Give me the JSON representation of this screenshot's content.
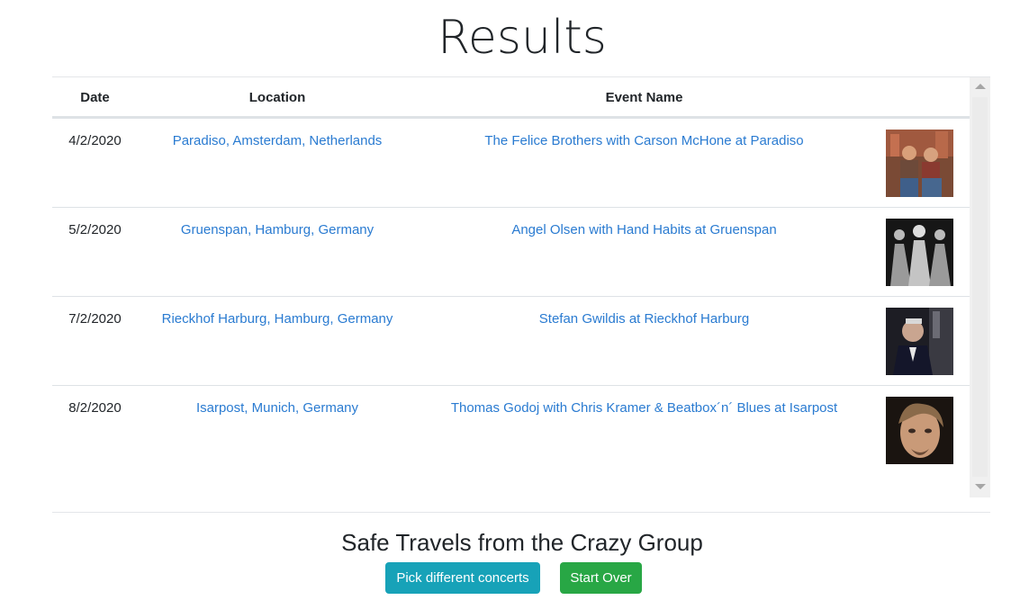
{
  "page": {
    "title": "Results"
  },
  "table": {
    "headers": {
      "date": "Date",
      "location": "Location",
      "event": "Event Name"
    },
    "rows": [
      {
        "date": "4/2/2020",
        "location": "Paradiso, Amsterdam, Netherlands",
        "event": "The Felice Brothers with Carson McHone at Paradiso",
        "image": "band-photo"
      },
      {
        "date": "5/2/2020",
        "location": "Gruenspan, Hamburg, Germany",
        "event": "Angel Olsen with Hand Habits at Gruenspan",
        "image": "artist-photo"
      },
      {
        "date": "7/2/2020",
        "location": "Rieckhof Harburg, Hamburg, Germany",
        "event": "Stefan Gwildis at Rieckhof Harburg",
        "image": "artist-photo"
      },
      {
        "date": "8/2/2020",
        "location": "Isarpost, Munich, Germany",
        "event": "Thomas Godoj with Chris Kramer & Beatbox´n´ Blues at Isarpost",
        "image": "artist-photo"
      }
    ]
  },
  "footer": {
    "message": "Safe Travels from the Crazy Group",
    "pick_button": "Pick different concerts",
    "start_over_button": "Start Over"
  },
  "colors": {
    "link": "#2a7bd1",
    "info_button": "#17a2b8",
    "success_button": "#28a745"
  }
}
